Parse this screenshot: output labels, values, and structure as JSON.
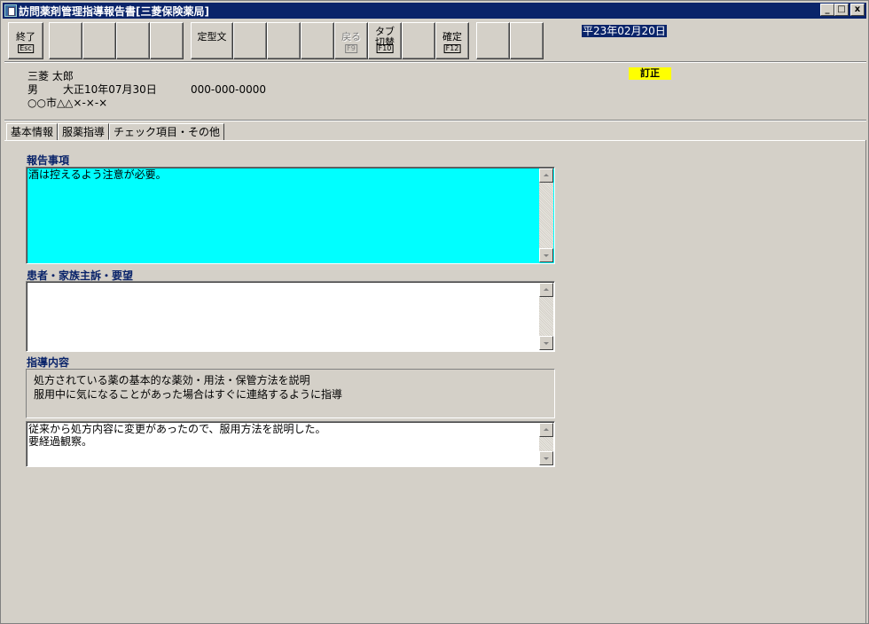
{
  "window": {
    "title": "訪問薬剤管理指導報告書[三菱保険薬局]",
    "minimize": "_",
    "maximize": "□",
    "close": "x"
  },
  "toolbar": {
    "exit_label": "終了",
    "exit_key": "Esc",
    "template_label": "定型文",
    "back_label": "戻る",
    "back_key": "F9",
    "tab_switch_label_line1": "タブ",
    "tab_switch_label_line2": "切替",
    "tab_switch_key": "F10",
    "confirm_label": "確定",
    "confirm_key": "F12"
  },
  "date": "平23年02月20日",
  "patient": {
    "name": "三菱 太郎",
    "sex": "男",
    "birthdate": "大正10年07月30日",
    "phone": "000-000-0000",
    "address": "○○市△△×-×-×"
  },
  "badge": "訂正",
  "tabs": [
    "基本情報",
    "服薬指導",
    "チェック項目・その他"
  ],
  "report": {
    "title": "報告事項",
    "value": "酒は控えるよう注意が必要。"
  },
  "complaint": {
    "title": "患者・家族主訴・要望",
    "value": ""
  },
  "guidance": {
    "title": "指導内容",
    "static_lines": [
      "処方されている薬の基本的な薬効・用法・保管方法を説明",
      "服用中に気になることがあった場合はすぐに連絡するように指導"
    ],
    "value": "従来から処方内容に変更があったので、服用方法を説明した。\n要経過観察。"
  },
  "colors": {
    "report_bg": "#00ffff",
    "badge_bg": "#ffff00",
    "title_bar": "#0a246a",
    "section_title": "#0a246a"
  }
}
